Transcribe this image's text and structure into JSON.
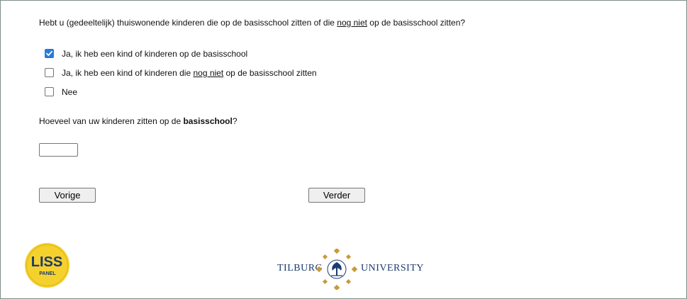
{
  "question1": {
    "pre": "Hebt u (gedeeltelijk) thuiswonende kinderen die op de basisschool zitten of die ",
    "emph": "nog niet",
    "post": " op de basisschool zitten?"
  },
  "options": [
    {
      "label": "Ja, ik heb een kind of kinderen op de basisschool",
      "checked": true
    },
    {
      "label_pre": "Ja, ik heb een kind of kinderen die ",
      "label_emph": "nog niet",
      "label_post": " op de basisschool zitten",
      "checked": false
    },
    {
      "label": "Nee",
      "checked": false
    }
  ],
  "question2": {
    "pre": "Hoeveel van uw kinderen zitten op de ",
    "bold": "basisschool",
    "post": "?"
  },
  "count_input": {
    "value": ""
  },
  "nav": {
    "prev_label": "Vorige",
    "next_label": "Verder"
  },
  "logos": {
    "liss_top": "LISS",
    "liss_bottom": "PANEL",
    "tilburg_left": "TILBURG",
    "tilburg_right": "UNIVERSITY"
  },
  "colors": {
    "checkbox_accent": "#2a7ad8",
    "liss_yellow": "#f5d12e",
    "tilburg_blue": "#1c3b6e",
    "tilburg_gold": "#c99a3a"
  }
}
